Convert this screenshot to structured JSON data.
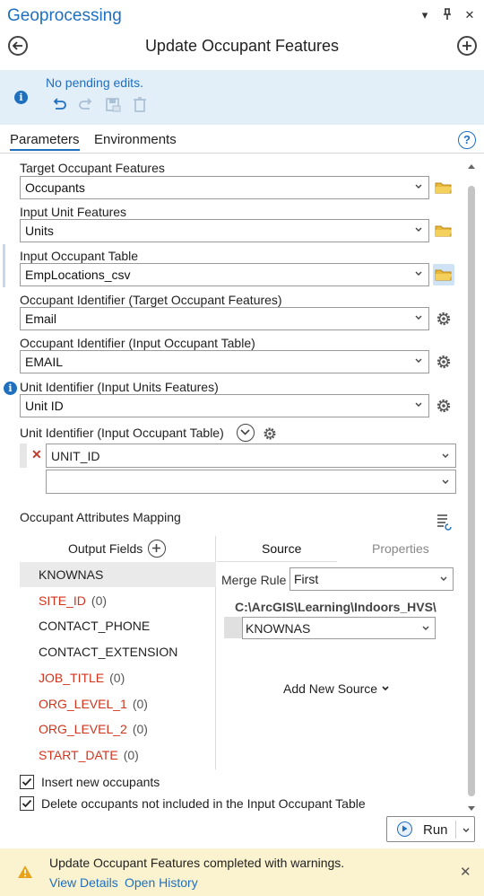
{
  "pane": {
    "title": "Geoprocessing"
  },
  "tool": {
    "title": "Update Occupant Features"
  },
  "edits": {
    "message": "No pending edits."
  },
  "tabs": [
    {
      "label": "Parameters"
    },
    {
      "label": "Environments"
    }
  ],
  "params": {
    "target_occupant_features": {
      "label": "Target Occupant Features",
      "value": "Occupants"
    },
    "input_unit_features": {
      "label": "Input Unit Features",
      "value": "Units"
    },
    "input_occupant_table": {
      "label": "Input Occupant Table",
      "value": "EmpLocations_csv"
    },
    "occupant_id_target": {
      "label": "Occupant Identifier (Target Occupant Features)",
      "value": "Email"
    },
    "occupant_id_input": {
      "label": "Occupant Identifier (Input Occupant Table)",
      "value": "EMAIL"
    },
    "unit_id_units": {
      "label": "Unit Identifier (Input Units Features)",
      "value": "Unit ID"
    },
    "unit_id_table": {
      "label": "Unit Identifier (Input Occupant Table)",
      "values": [
        "UNIT_ID",
        ""
      ]
    }
  },
  "mapping": {
    "label": "Occupant Attributes Mapping",
    "output_fields_header": "Output Fields",
    "fields": [
      {
        "name": "KNOWNAS",
        "count": "",
        "required": false,
        "selected": true
      },
      {
        "name": "SITE_ID",
        "count": "(0)",
        "required": true,
        "selected": false
      },
      {
        "name": "CONTACT_PHONE",
        "count": "",
        "required": false,
        "selected": false
      },
      {
        "name": "CONTACT_EXTENSION",
        "count": "",
        "required": false,
        "selected": false
      },
      {
        "name": "JOB_TITLE",
        "count": "(0)",
        "required": true,
        "selected": false
      },
      {
        "name": "ORG_LEVEL_1",
        "count": "(0)",
        "required": true,
        "selected": false
      },
      {
        "name": "ORG_LEVEL_2",
        "count": "(0)",
        "required": true,
        "selected": false
      },
      {
        "name": "START_DATE",
        "count": "(0)",
        "required": true,
        "selected": false
      }
    ],
    "source_tab": "Source",
    "properties_tab": "Properties",
    "merge_rule_label": "Merge Rule",
    "merge_rule_value": "First",
    "source_path": "C:\\ArcGIS\\Learning\\Indoors_HVS\\",
    "source_field": "KNOWNAS",
    "add_new_source": "Add New Source"
  },
  "options": {
    "insert_new_occupants": {
      "label": "Insert new occupants",
      "checked": true
    },
    "delete_not_included": {
      "label": "Delete occupants not included in the Input Occupant Table",
      "checked": true
    }
  },
  "run": {
    "label": "Run"
  },
  "status": {
    "message": "Update Occupant Features completed with warnings.",
    "view_details": "View Details",
    "open_history": "Open History"
  },
  "colors": {
    "accent": "#1f6fbf",
    "required_field": "#d0341d",
    "warning": "#e8a21a",
    "edit_banner_bg": "#e2eef8",
    "status_bar_bg": "#fbf3cf"
  }
}
